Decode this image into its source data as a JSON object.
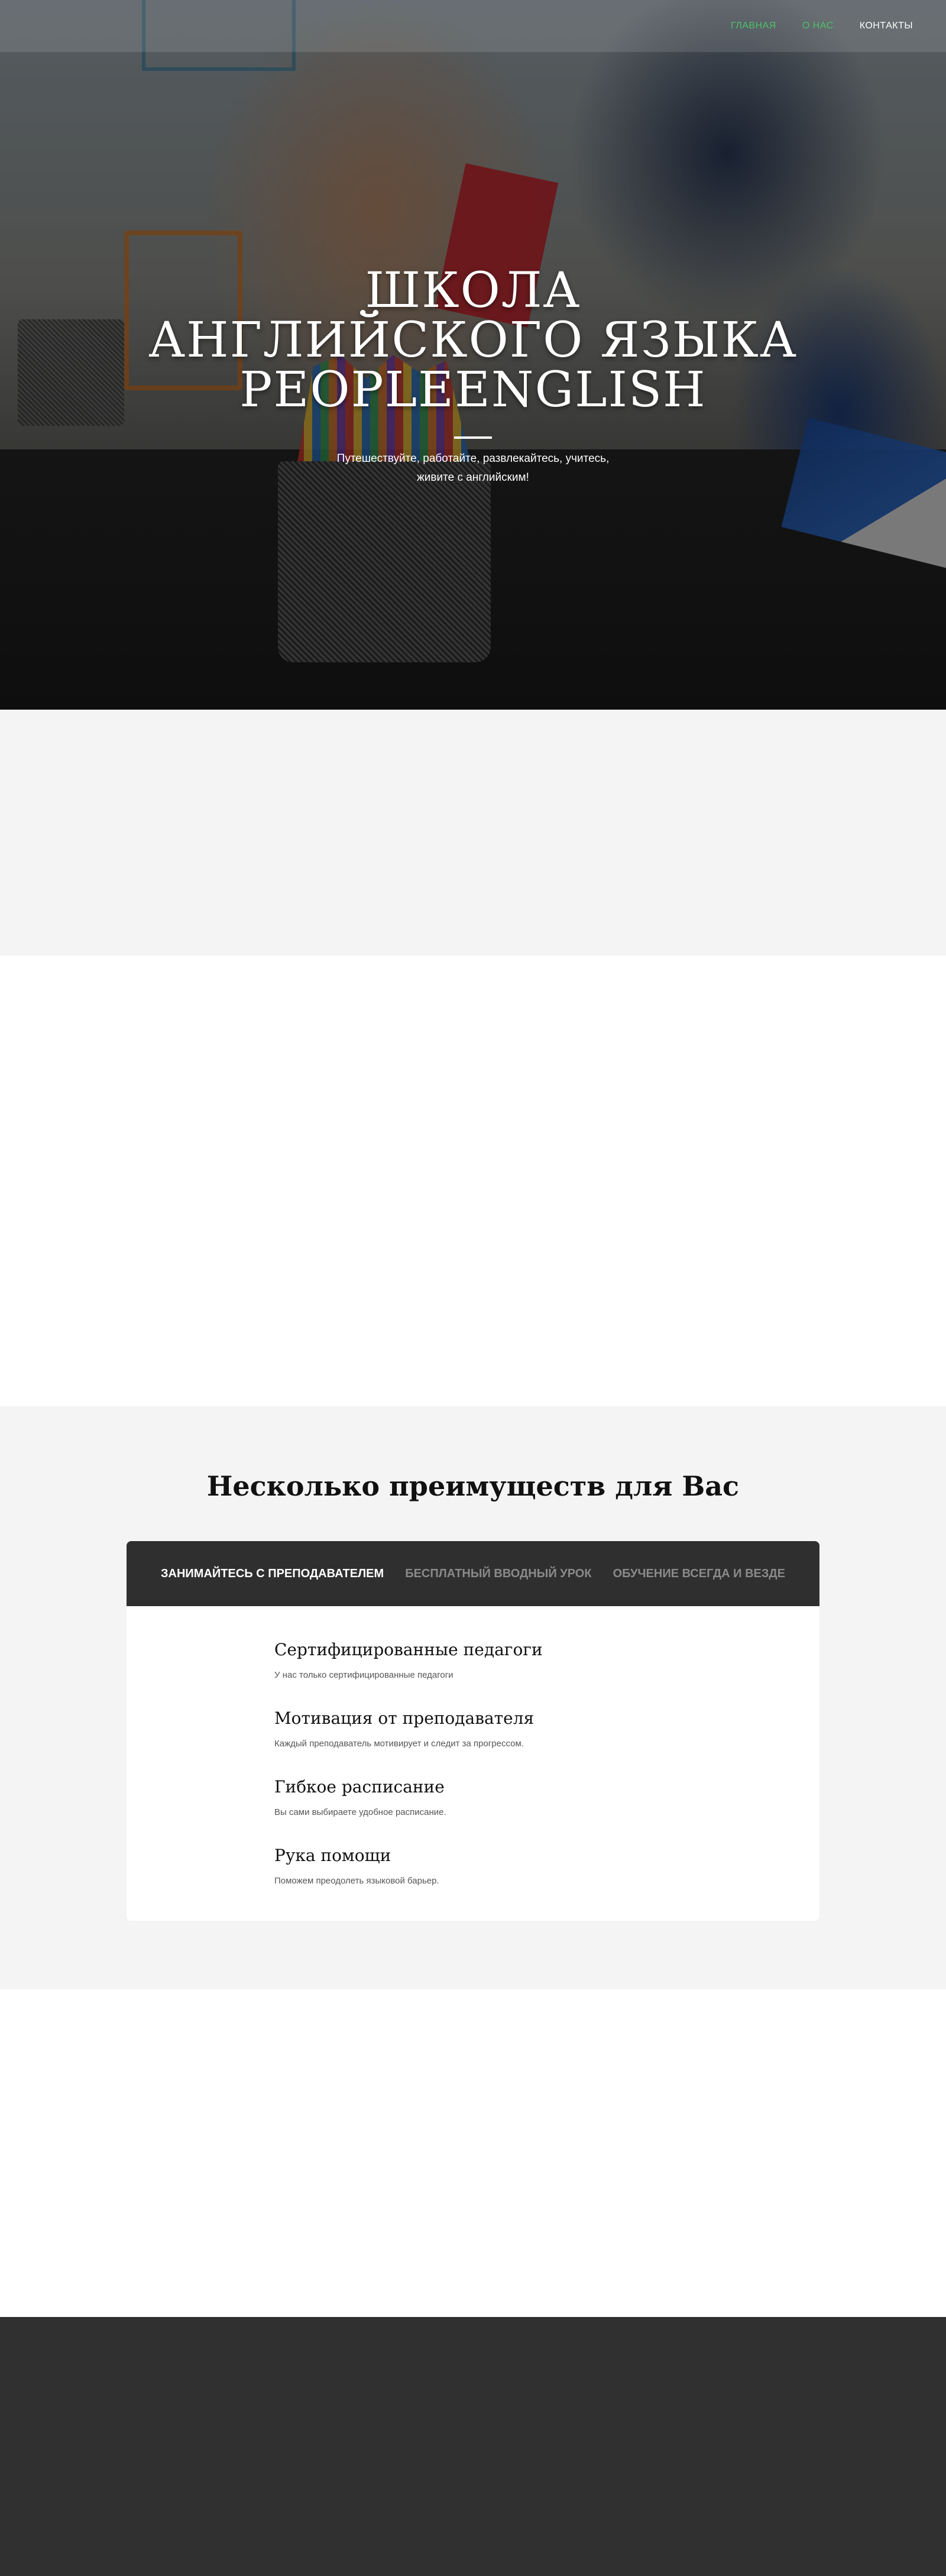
{
  "nav": {
    "items": [
      {
        "label": "Главная",
        "active": true
      },
      {
        "label": "О нас",
        "active": true
      },
      {
        "label": "Контакты",
        "active": false
      }
    ],
    "accent_color": "#4fc06b"
  },
  "hero": {
    "title": "Школа английского языка PeopleEnglish",
    "subtitle": "Путешествуйте, работайте, развлекайтесь, учитесь, живите с английским!"
  },
  "benefits": {
    "title": "Несколько преимуществ для Вас",
    "tabs": [
      {
        "label": "Занимайтесь с преподавателем",
        "active": true
      },
      {
        "label": "Бесплатный вводный урок",
        "active": false
      },
      {
        "label": "Обучение всегда и везде",
        "active": false
      }
    ],
    "features": [
      {
        "title": "Сертифицированные педагоги",
        "text": "У нас только сертифицированные педагоги"
      },
      {
        "title": "Мотивация от преподавателя",
        "text": "Каждый преподаватель мотивирует и следит за прогрессом."
      },
      {
        "title": "Гибкое расписание",
        "text": "Вы сами выбираете удобное расписание."
      },
      {
        "title": "Рука помощи",
        "text": "Поможем преодолеть языковой барьер."
      }
    ]
  },
  "colors": {
    "section_gray": "#f4f4f4",
    "dark": "#303030"
  }
}
